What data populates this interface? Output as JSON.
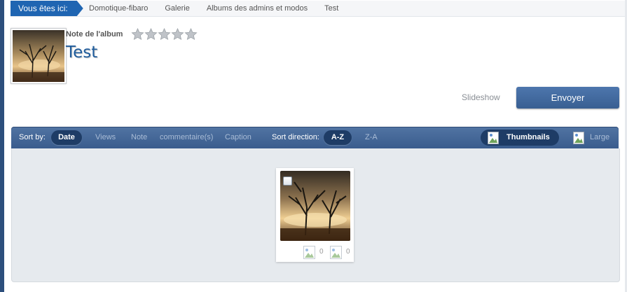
{
  "breadcrumb": {
    "label": "Vous êtes ici:",
    "items": [
      "Domotique-fibaro",
      "Galerie",
      "Albums des admins et modos",
      "Test"
    ]
  },
  "album": {
    "rating_label": "Note de l'album",
    "rating": {
      "value": 0,
      "max": 5
    },
    "title": "Test"
  },
  "actions": {
    "slideshow_label": "Slideshow",
    "send_label": "Envoyer"
  },
  "sortbar": {
    "sort_by_label": "Sort by:",
    "sort_options": [
      "Date",
      "Views",
      "Note",
      "commentaire(s)",
      "Caption"
    ],
    "sort_selected": "Date",
    "direction_label": "Sort direction:",
    "directions": [
      "A-Z",
      "Z-A"
    ],
    "direction_selected": "A-Z",
    "view_modes": [
      "Thumbnails",
      "Large"
    ],
    "view_selected": "Thumbnails"
  },
  "images": [
    {
      "views": "0",
      "comments": "0"
    }
  ],
  "colors": {
    "accent": "#1f65b2",
    "bar": "#46699a",
    "title": "#1f5c9c",
    "button": "#4369a0"
  }
}
